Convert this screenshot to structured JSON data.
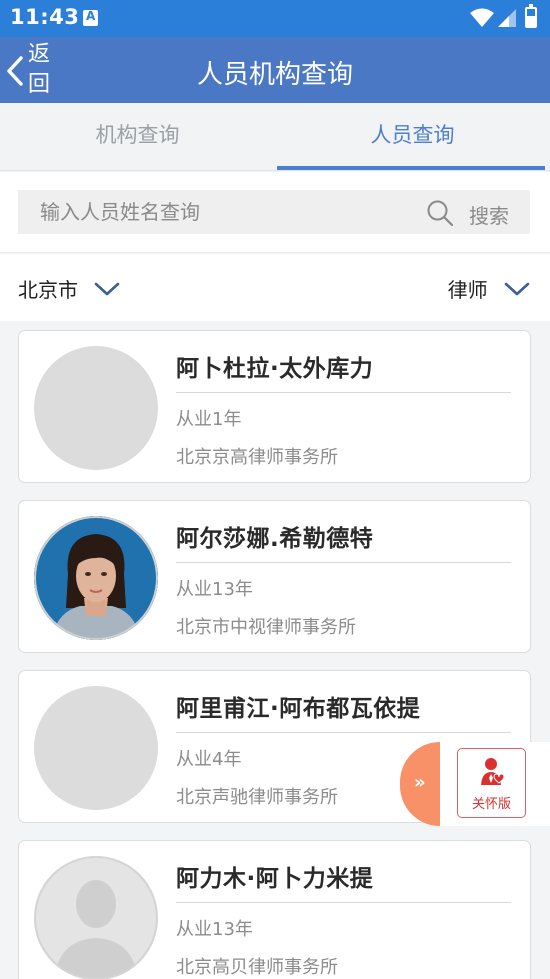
{
  "status_bar": {
    "time": "11:43"
  },
  "nav": {
    "back_label": "返回",
    "title": "人员机构查询"
  },
  "tabs": [
    {
      "label": "机构查询",
      "active": false
    },
    {
      "label": "人员查询",
      "active": true
    }
  ],
  "search": {
    "placeholder": "输入人员姓名查询",
    "button_label": "搜索"
  },
  "filters": {
    "region": "北京市",
    "role": "律师"
  },
  "people": [
    {
      "name": "阿卜杜拉·太外库力",
      "years": "从业1年",
      "firm": "北京京高律师事务所",
      "avatar": "blank-avatar"
    },
    {
      "name": "阿尔莎娜.希勒德特",
      "years": "从业13年",
      "firm": "北京市中视律师事务所",
      "avatar": "photo-avatar"
    },
    {
      "name": "阿里甫江·阿布都瓦依提",
      "years": "从业4年",
      "firm": "北京声驰律师事务所",
      "avatar": "blank-avatar"
    },
    {
      "name": "阿力木·阿卜力米提",
      "years": "从业13年",
      "firm": "北京高贝律师事务所",
      "avatar": "silhouette-avatar"
    }
  ],
  "floating": {
    "toggle_icon": "»",
    "care_label": "关怀版"
  },
  "colors": {
    "status_bar": "#2b7fd9",
    "nav_bar": "#4b78c4",
    "accent": "#4d7fcf",
    "care_red": "#d93030",
    "float_orange": "#f89068"
  }
}
